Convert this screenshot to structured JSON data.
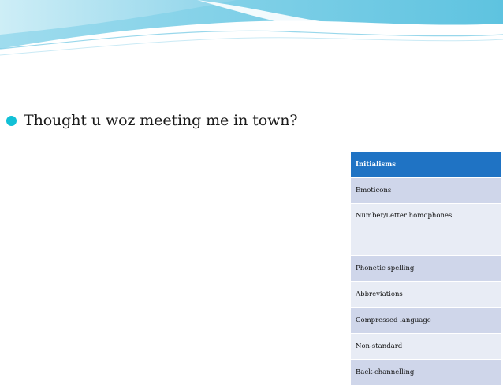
{
  "slide": {
    "bullet_text": "Thought u woz meeting me in town?"
  },
  "table": {
    "header": "Initialisms",
    "rows": [
      "Emoticons",
      "Number/Letter homophones",
      "Phonetic spelling",
      "Abbreviations",
      "Compressed language",
      "Non-standard",
      "Back-channelling"
    ]
  },
  "colors": {
    "accent": "#12c0d6",
    "header": "#1f73c4",
    "row_dark": "#cfd6ea",
    "row_light": "#e8ecf5"
  }
}
